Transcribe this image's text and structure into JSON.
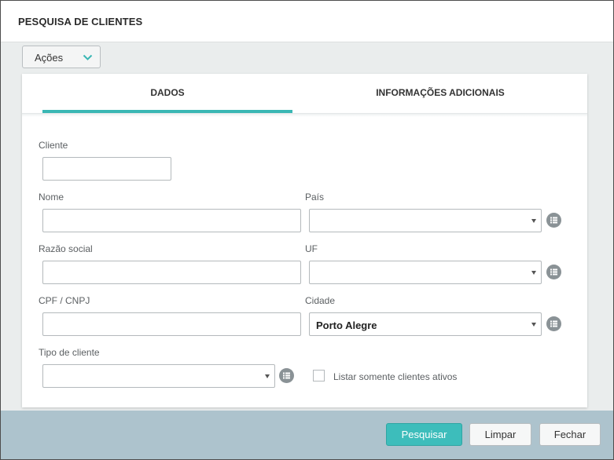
{
  "dialog": {
    "title": "PESQUISA DE CLIENTES"
  },
  "actions": {
    "label": "Ações",
    "icon": "chevron-down-icon",
    "icon_color": "#3ab7b4"
  },
  "tabs": [
    {
      "label": "DADOS",
      "active": true
    },
    {
      "label": "INFORMAÇÕES ADICIONAIS",
      "active": false
    }
  ],
  "form": {
    "cliente": {
      "label": "Cliente",
      "value": ""
    },
    "nome": {
      "label": "Nome",
      "value": ""
    },
    "pais": {
      "label": "País",
      "value": ""
    },
    "razao_social": {
      "label": "Razão social",
      "value": ""
    },
    "uf": {
      "label": "UF",
      "value": ""
    },
    "cpf_cnpj": {
      "label": "CPF / CNPJ",
      "value": ""
    },
    "cidade": {
      "label": "Cidade",
      "value": "Porto Alegre"
    },
    "tipo_cliente": {
      "label": "Tipo de cliente",
      "value": ""
    },
    "somente_ativos": {
      "label": "Listar somente clientes ativos",
      "checked": false
    }
  },
  "icons": {
    "list_button": "list-icon",
    "list_button_color": "#8a9296"
  },
  "footer": {
    "search_label": "Pesquisar",
    "clear_label": "Limpar",
    "close_label": "Fechar"
  },
  "colors": {
    "accent": "#3ab7b4",
    "footer_bg": "#adc3cd"
  }
}
